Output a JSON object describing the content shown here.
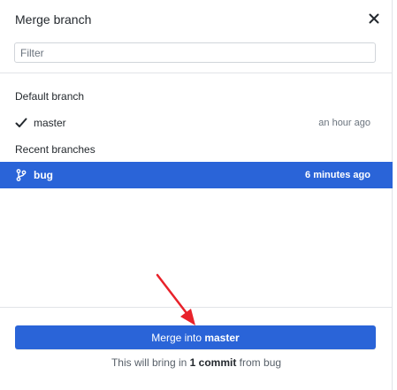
{
  "dialog": {
    "title": "Merge branch",
    "close_icon": "close-icon"
  },
  "filter": {
    "placeholder": "Filter",
    "value": ""
  },
  "default_branch": {
    "header": "Default branch",
    "items": [
      {
        "icon": "check-icon",
        "name": "master",
        "time": "an hour ago",
        "selected": false
      }
    ]
  },
  "recent_branches": {
    "header": "Recent branches",
    "items": [
      {
        "icon": "git-branch-icon",
        "name": "bug",
        "time": "6 minutes ago",
        "selected": true
      }
    ]
  },
  "footer": {
    "button_prefix": "Merge into ",
    "button_target": "master",
    "summary_prefix": "This will bring in ",
    "summary_count": "1 commit",
    "summary_from": " from ",
    "summary_branch": "bug"
  },
  "colors": {
    "accent": "#2a64d8",
    "annotation_arrow": "#e8222a"
  }
}
